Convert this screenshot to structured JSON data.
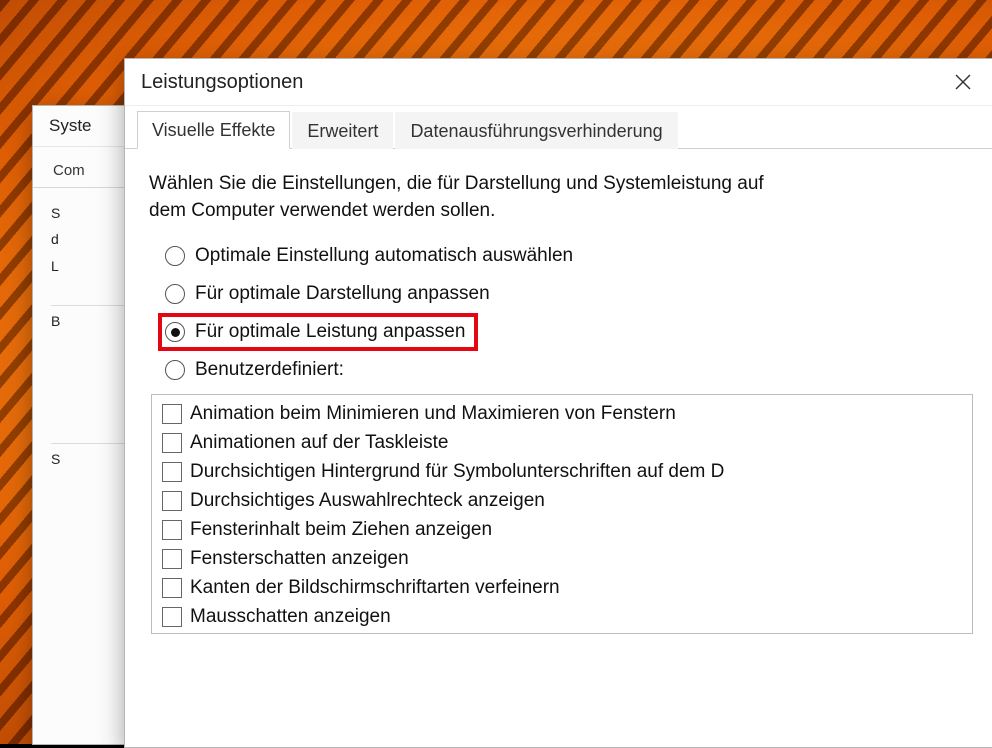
{
  "wallpaper": {
    "palette": [
      "#f7b24a",
      "#e48523",
      "#c55a10",
      "#7a2b07",
      "#2e0e03"
    ]
  },
  "bg_window": {
    "title_partial": "Syste",
    "tab_partial": "Com",
    "body": {
      "line1": "S",
      "line2": "d",
      "line3": "L",
      "section_b_label": "B",
      "section_s_label": "S"
    }
  },
  "perf": {
    "title": "Leistungsoptionen",
    "close_icon": "close-icon",
    "tabs": [
      {
        "label": "Visuelle Effekte",
        "active": true
      },
      {
        "label": "Erweitert",
        "active": false
      },
      {
        "label": "Datenausführungsverhinderung",
        "active": false
      }
    ],
    "description": "Wählen Sie die Einstellungen, die für Darstellung und Systemleistung auf dem Computer verwendet werden sollen.",
    "radios": [
      {
        "label": "Optimale Einstellung automatisch auswählen",
        "checked": false,
        "highlight": false
      },
      {
        "label": "Für optimale Darstellung anpassen",
        "checked": false,
        "highlight": false
      },
      {
        "label": "Für optimale Leistung anpassen",
        "checked": true,
        "highlight": true
      },
      {
        "label": "Benutzerdefiniert:",
        "checked": false,
        "highlight": false
      }
    ],
    "checks": [
      {
        "label": "Animation beim Minimieren und Maximieren von Fenstern",
        "checked": false
      },
      {
        "label": "Animationen auf der Taskleiste",
        "checked": false
      },
      {
        "label": "Durchsichtigen Hintergrund für Symbolunterschriften auf dem D",
        "checked": false
      },
      {
        "label": "Durchsichtiges Auswahlrechteck anzeigen",
        "checked": false
      },
      {
        "label": "Fensterinhalt beim Ziehen anzeigen",
        "checked": false
      },
      {
        "label": "Fensterschatten anzeigen",
        "checked": false
      },
      {
        "label": "Kanten der Bildschirmschriftarten verfeinern",
        "checked": false
      },
      {
        "label": "Mausschatten anzeigen",
        "checked": false
      }
    ],
    "highlight_color": "#e30613"
  }
}
